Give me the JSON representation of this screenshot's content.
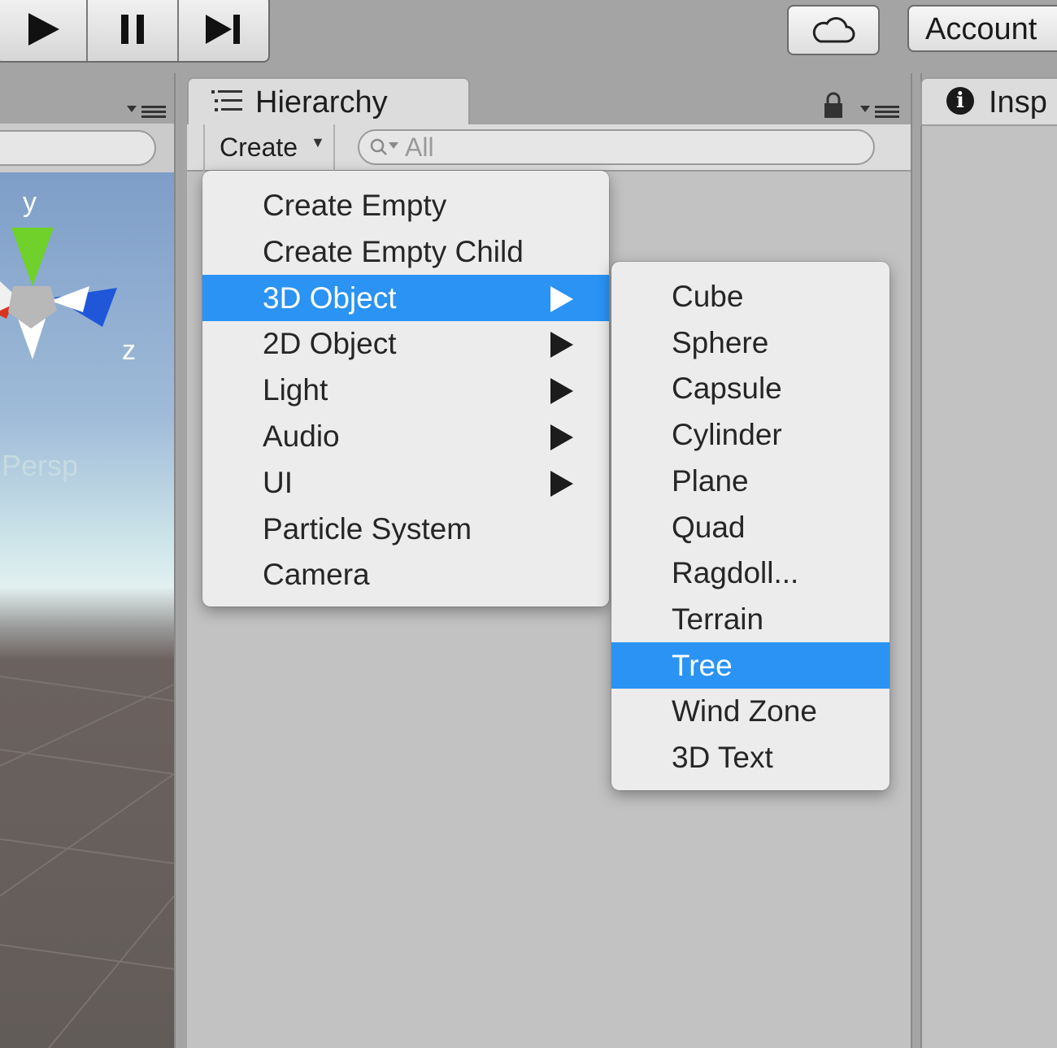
{
  "toolbar": {
    "play_icon": "play-icon",
    "pause_icon": "pause-icon",
    "step_icon": "step-forward-icon",
    "cloud_icon": "cloud-icon",
    "account_label": "Account"
  },
  "scene": {
    "axis_y": "y",
    "axis_z": "z",
    "persp_label": "Persp"
  },
  "hierarchy": {
    "tab_label": "Hierarchy",
    "create_label": "Create",
    "search_placeholder": "All"
  },
  "inspector": {
    "tab_label": "Insp",
    "info_glyph": "i"
  },
  "create_menu": {
    "items": [
      {
        "label": "Create Empty",
        "submenu": false,
        "highlighted": false
      },
      {
        "label": "Create Empty Child",
        "submenu": false,
        "highlighted": false
      },
      {
        "label": "3D Object",
        "submenu": true,
        "highlighted": true
      },
      {
        "label": "2D Object",
        "submenu": true,
        "highlighted": false
      },
      {
        "label": "Light",
        "submenu": true,
        "highlighted": false
      },
      {
        "label": "Audio",
        "submenu": true,
        "highlighted": false
      },
      {
        "label": "UI",
        "submenu": true,
        "highlighted": false
      },
      {
        "label": "Particle System",
        "submenu": false,
        "highlighted": false
      },
      {
        "label": "Camera",
        "submenu": false,
        "highlighted": false
      }
    ]
  },
  "object3d_menu": {
    "items": [
      {
        "label": "Cube",
        "highlighted": false
      },
      {
        "label": "Sphere",
        "highlighted": false
      },
      {
        "label": "Capsule",
        "highlighted": false
      },
      {
        "label": "Cylinder",
        "highlighted": false
      },
      {
        "label": "Plane",
        "highlighted": false
      },
      {
        "label": "Quad",
        "highlighted": false
      },
      {
        "label": "Ragdoll...",
        "highlighted": false
      },
      {
        "label": "Terrain",
        "highlighted": false
      },
      {
        "label": "Tree",
        "highlighted": true
      },
      {
        "label": "Wind Zone",
        "highlighted": false
      },
      {
        "label": "3D Text",
        "highlighted": false
      }
    ]
  },
  "colors": {
    "highlight": "#2a93f4",
    "menu_bg": "#ececec",
    "gizmo_y": "#6fd12a",
    "gizmo_z": "#1f57d8",
    "gizmo_x": "#d8351f"
  }
}
